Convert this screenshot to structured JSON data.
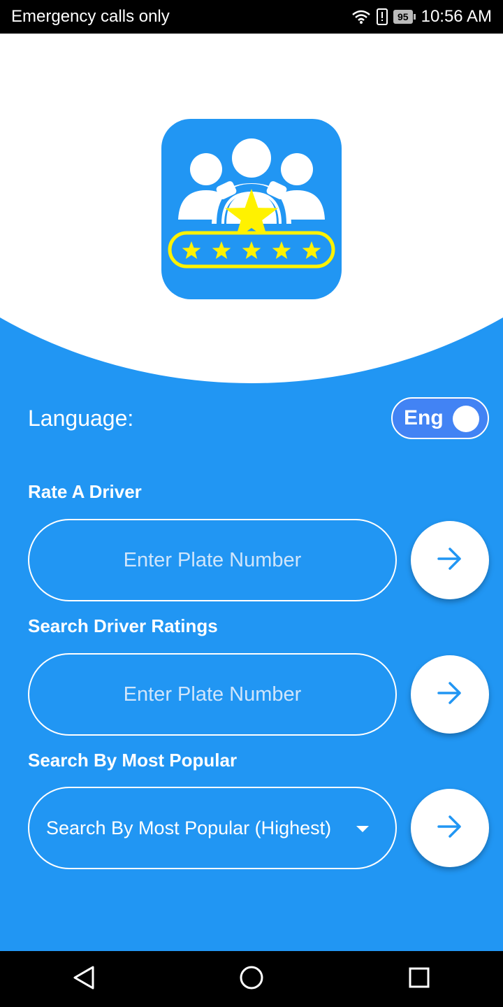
{
  "status_bar": {
    "carrier_text": "Emergency calls only",
    "battery_level": "95",
    "time": "10:56 AM",
    "icons": [
      "wifi-icon",
      "alert-icon",
      "battery-icon"
    ]
  },
  "colors": {
    "primary": "#2196F3",
    "white": "#FFFFFF",
    "logo_star": "#FFF200",
    "toggle_bg": "#4283F4"
  },
  "language": {
    "label": "Language:",
    "toggle_text": "Eng"
  },
  "rate_driver": {
    "label": "Rate A Driver",
    "placeholder": "Enter Plate Number",
    "button_icon": "arrow-right-icon"
  },
  "search_ratings": {
    "label": "Search Driver Ratings",
    "placeholder": "Enter Plate Number",
    "button_icon": "arrow-right-icon"
  },
  "most_popular": {
    "label": "Search By Most Popular",
    "selected": "Search By Most Popular (Highest)",
    "button_icon": "arrow-right-icon"
  },
  "nav_bar": {
    "icons": [
      "back-icon",
      "home-icon",
      "recents-icon"
    ]
  }
}
